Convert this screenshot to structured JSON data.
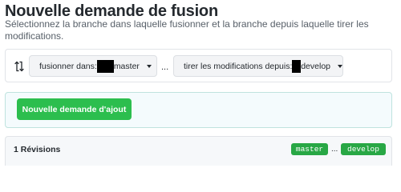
{
  "page": {
    "title": "Nouvelle demande de fusion",
    "subtitle": "Sélectionnez la branche dans laquelle fusionner et la branche depuis laquelle tirer les modifications."
  },
  "compare": {
    "icon": "compare-arrows-icon",
    "base_label": "fusionner dans:",
    "base_branch": "master",
    "separator": "...",
    "head_label": "tirer les modifications depuis:",
    "head_branch": "develop"
  },
  "create": {
    "button_label": "Nouvelle demande d'ajout",
    "button_color": "#2cbe4e"
  },
  "revisions": {
    "label": "1 Révisions",
    "base_tag": "master",
    "separator": "...",
    "head_tag": "develop",
    "tag_color": "#28a745"
  }
}
